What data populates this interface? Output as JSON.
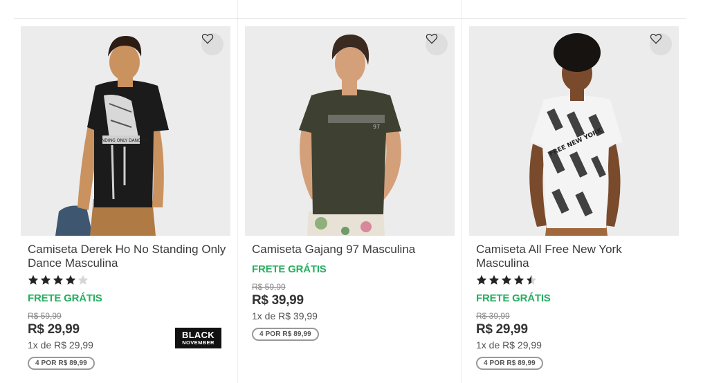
{
  "products": [
    {
      "title": "Camiseta Derek Ho No Standing Only Dance Masculina",
      "rating": 4,
      "rating_max": 5,
      "shipping": "FRETE GRÁTIS",
      "old_price": "R$ 59,99",
      "price": "R$ 29,99",
      "installments": "1x de R$ 29,99",
      "promo": "4 POR R$ 89,99",
      "badge_line1": "BLACK",
      "badge_line2": "NOVEMBER"
    },
    {
      "title": "Camiseta Gajang 97 Masculina",
      "shipping": "FRETE GRÁTIS",
      "old_price": "R$ 59,99",
      "price": "R$ 39,99",
      "installments": "1x de R$ 39,99",
      "promo": "4 POR R$ 89,99"
    },
    {
      "title": "Camiseta All Free New York Masculina",
      "rating": 4.5,
      "rating_max": 5,
      "shipping": "FRETE GRÁTIS",
      "old_price": "R$ 39,99",
      "price": "R$ 29,99",
      "installments": "1x de R$ 29,99",
      "promo": "4 POR R$ 89,99"
    }
  ],
  "shirt_prints": {
    "p1_print": "STANDING ONLY DANCING",
    "p2_print": "97",
    "p3_print": "FREE NEW YORK"
  },
  "colors": {
    "shipping_green": "#27ae60",
    "badge_black": "#111111",
    "photo_bg": "#ececec"
  },
  "icons": {
    "favorite": "heart-outline-icon",
    "star": "star-icon"
  }
}
